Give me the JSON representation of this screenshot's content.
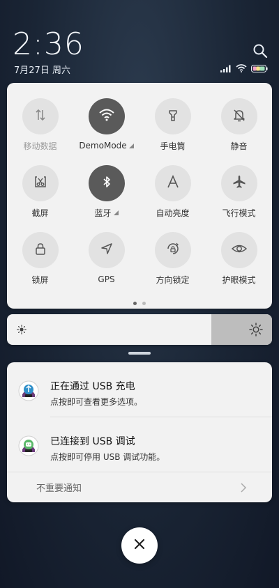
{
  "status": {
    "time": "2:36",
    "date": "7月27日 周六"
  },
  "quick_settings": {
    "tiles": [
      {
        "label": "移动数据",
        "icon": "mobile-data-icon",
        "active": false,
        "disabled": true
      },
      {
        "label": "DemoMode",
        "icon": "wifi-icon",
        "active": true,
        "disabled": false
      },
      {
        "label": "手电筒",
        "icon": "flashlight-icon",
        "active": false,
        "disabled": false
      },
      {
        "label": "静音",
        "icon": "bell-off-icon",
        "active": false,
        "disabled": false
      },
      {
        "label": "截屏",
        "icon": "screenshot-icon",
        "active": false,
        "disabled": false
      },
      {
        "label": "蓝牙",
        "icon": "bluetooth-icon",
        "active": true,
        "disabled": false
      },
      {
        "label": "自动亮度",
        "icon": "auto-brightness-icon",
        "active": false,
        "disabled": false
      },
      {
        "label": "飞行模式",
        "icon": "airplane-icon",
        "active": false,
        "disabled": false
      },
      {
        "label": "锁屏",
        "icon": "lock-icon",
        "active": false,
        "disabled": false
      },
      {
        "label": "GPS",
        "icon": "gps-icon",
        "active": false,
        "disabled": false
      },
      {
        "label": "方向锁定",
        "icon": "rotation-lock-icon",
        "active": false,
        "disabled": false
      },
      {
        "label": "护眼模式",
        "icon": "eye-icon",
        "active": false,
        "disabled": false
      }
    ],
    "page_current": 1,
    "page_count": 2
  },
  "brightness": {
    "level": 0.77
  },
  "notifications": [
    {
      "title": "正在通过 USB 充电",
      "body": "点按即可查看更多选项。",
      "icon": "usb-icon"
    },
    {
      "title": "已连接到 USB 调试",
      "body": "点按即可停用 USB 调试功能。",
      "icon": "android-debug-icon"
    }
  ],
  "unimportant_label": "不重要通知",
  "colors": {
    "panel": "#f2f2f2",
    "tile_inactive": "#e2e2e2",
    "tile_active": "#5a5a5a",
    "brightness_fill": "#bdbdbd"
  }
}
